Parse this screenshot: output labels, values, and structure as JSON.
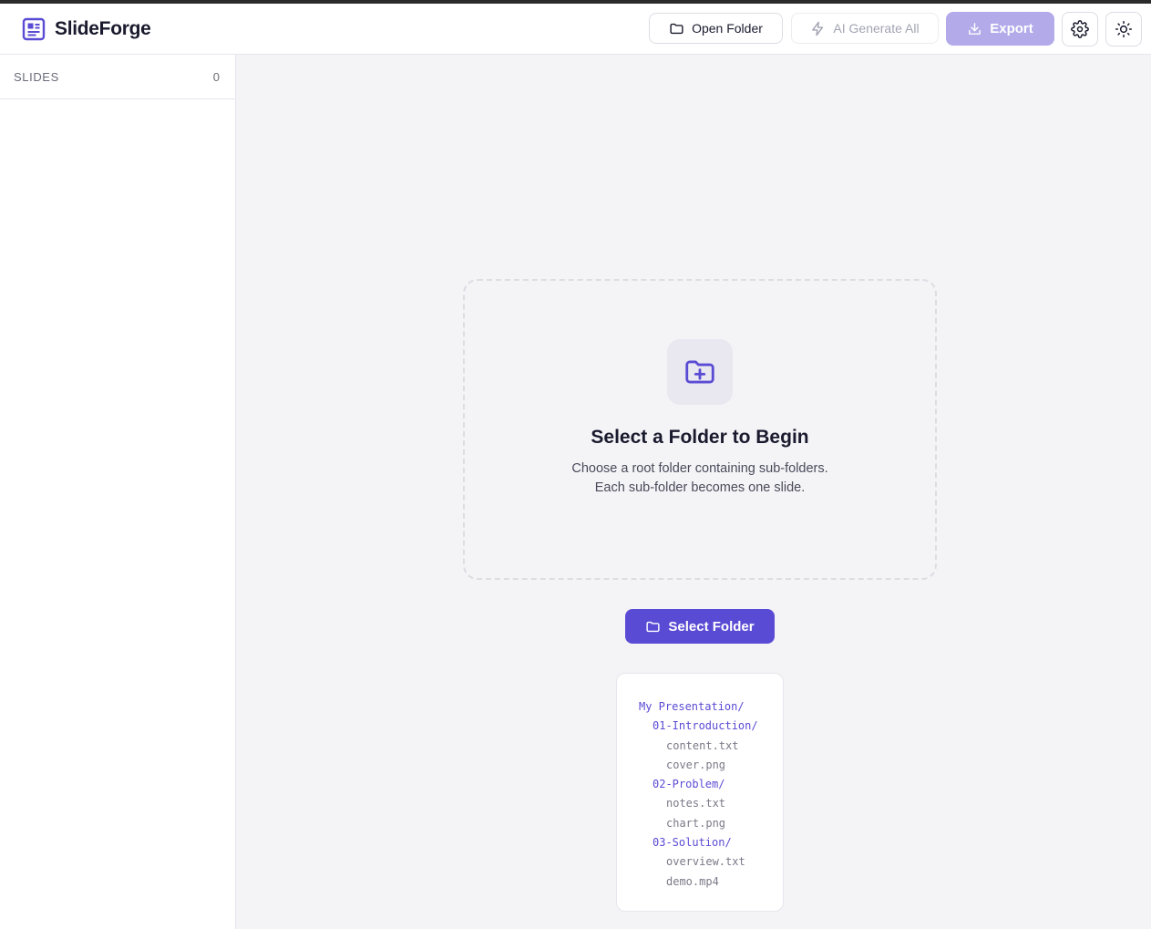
{
  "app": {
    "name": "SlideForge"
  },
  "toolbar": {
    "open_folder_label": "Open Folder",
    "ai_generate_label": "AI Generate All",
    "export_label": "Export",
    "settings_icon": "gear-icon",
    "theme_icon": "sun-icon"
  },
  "sidebar": {
    "title": "SLIDES",
    "count": "0"
  },
  "empty_state": {
    "icon": "folder-plus-icon",
    "title": "Select a Folder to Begin",
    "description_line1": "Choose a root folder containing sub-folders.",
    "description_line2": "Each sub-folder becomes one slide.",
    "select_button_label": "Select Folder"
  },
  "example_tree": {
    "root": "My Presentation/",
    "folders": [
      {
        "name": "01-Introduction/",
        "files": [
          "content.txt",
          "cover.png"
        ]
      },
      {
        "name": "02-Problem/",
        "files": [
          "notes.txt",
          "chart.png"
        ]
      },
      {
        "name": "03-Solution/",
        "files": [
          "overview.txt",
          "demo.mp4"
        ]
      }
    ]
  },
  "colors": {
    "accent": "#5a4bd4",
    "accent_disabled": "#b3aaea",
    "background": "#f4f4f7"
  }
}
